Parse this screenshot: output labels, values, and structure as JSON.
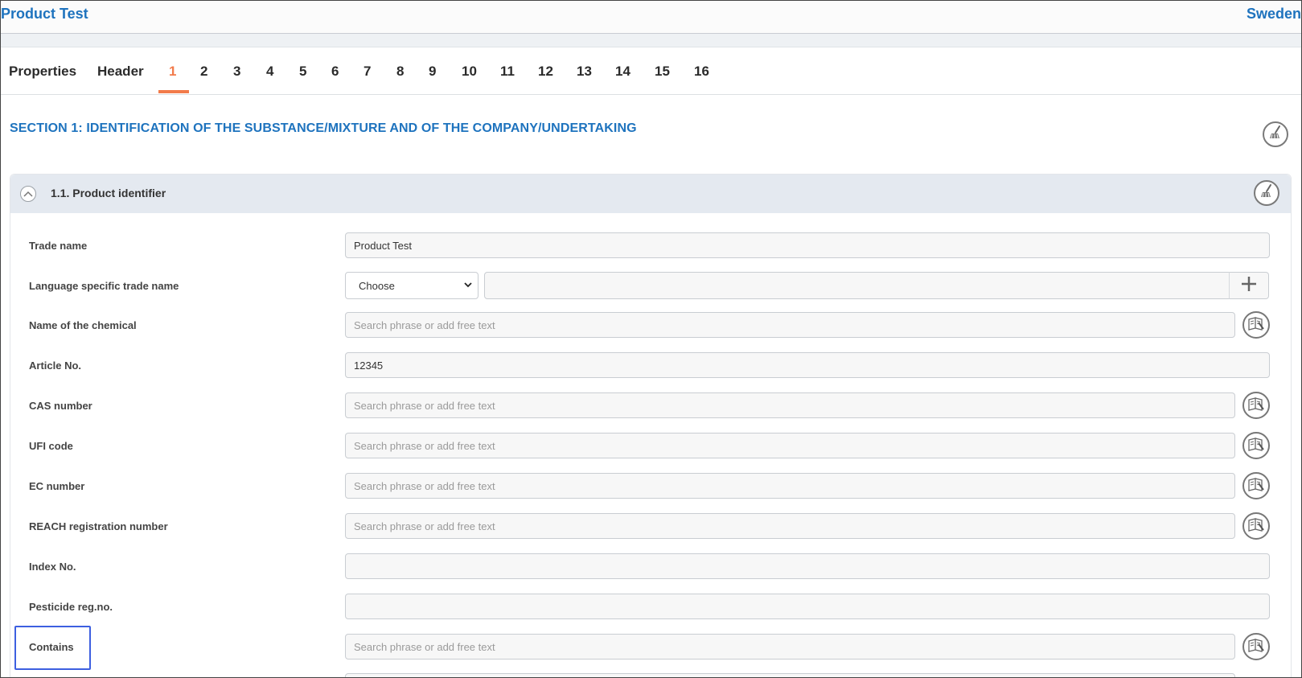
{
  "app": {
    "title": "Product Test",
    "country": "Sweden"
  },
  "tabs": [
    "Properties",
    "Header",
    "1",
    "2",
    "3",
    "4",
    "5",
    "6",
    "7",
    "8",
    "9",
    "10",
    "11",
    "12",
    "13",
    "14",
    "15",
    "16"
  ],
  "active_tab": "1",
  "section": {
    "title": "SECTION 1: IDENTIFICATION OF THE SUBSTANCE/MIXTURE AND OF THE COMPANY/UNDERTAKING"
  },
  "panel": {
    "title": "1.1. Product identifier"
  },
  "fields": {
    "trade_name": {
      "label": "Trade name",
      "value": "Product Test"
    },
    "language_trade_name": {
      "label": "Language specific trade name",
      "select_value": "Choose",
      "value": ""
    },
    "chemical_name": {
      "label": "Name of the chemical",
      "placeholder": "Search phrase or add free text"
    },
    "article_no": {
      "label": "Article No.",
      "value": "12345"
    },
    "cas_number": {
      "label": "CAS number",
      "placeholder": "Search phrase or add free text"
    },
    "ufi_code": {
      "label": "UFI code",
      "placeholder": "Search phrase or add free text"
    },
    "ec_number": {
      "label": "EC number",
      "placeholder": "Search phrase or add free text"
    },
    "reach_number": {
      "label": "REACH registration number",
      "placeholder": "Search phrase or add free text"
    },
    "index_no": {
      "label": "Index No.",
      "value": ""
    },
    "pesticide_no": {
      "label": "Pesticide reg.no.",
      "value": ""
    },
    "contains": {
      "label": "Contains",
      "placeholder": "Search phrase or add free text"
    }
  },
  "colors": {
    "accent": "#1e73be",
    "active_tab": "#f27b4b",
    "highlight": "#3d5fe0"
  },
  "icons": {
    "clear": "broom-icon",
    "phrase": "phrase-book-icon",
    "add": "plus-icon",
    "collapse": "chevron-up-icon"
  }
}
